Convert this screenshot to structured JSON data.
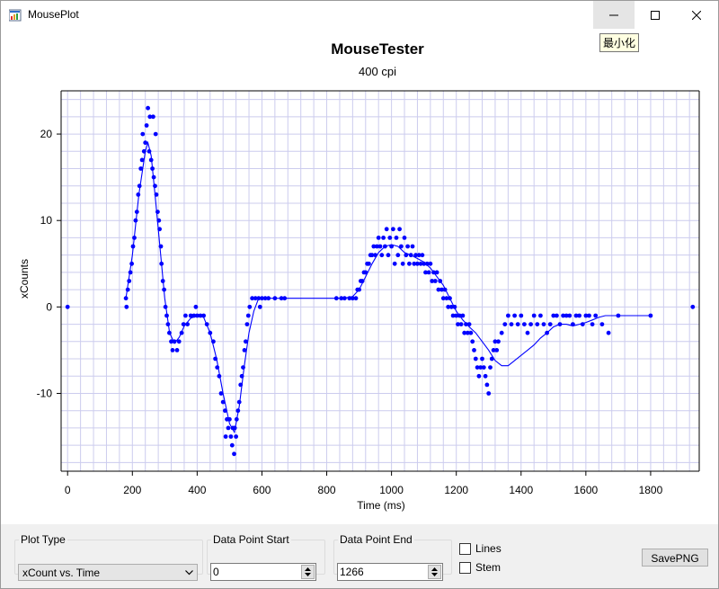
{
  "window": {
    "title": "MousePlot",
    "tooltip": "最小化"
  },
  "controls": {
    "plot_type_label": "Plot Type",
    "plot_type_value": "xCount vs. Time",
    "start_label": "Data Point Start",
    "start_value": "0",
    "end_label": "Data Point End",
    "end_value": "1266",
    "lines_label": "Lines",
    "stem_label": "Stem",
    "save_label": "SavePNG"
  },
  "chart_data": {
    "type": "scatter",
    "title": "MouseTester",
    "subtitle": "400 cpi",
    "xlabel": "Time (ms)",
    "ylabel": "xCounts",
    "xlim": [
      -20,
      1950
    ],
    "ylim": [
      -19,
      25
    ],
    "xticks": [
      0,
      200,
      400,
      600,
      800,
      1000,
      1200,
      1400,
      1600,
      1800
    ],
    "yticks": [
      -10,
      0,
      10,
      20
    ],
    "minor_grid_x_step": 40,
    "minor_grid_y_step": 2,
    "grid": true,
    "colors": {
      "points": "#0000ff",
      "line": "#0000ff",
      "grid": "#ccccee",
      "axis": "#000000"
    },
    "series": [
      {
        "points": [
          [
            0,
            0
          ],
          [
            180,
            1
          ],
          [
            182,
            0
          ],
          [
            186,
            2
          ],
          [
            190,
            3
          ],
          [
            194,
            4
          ],
          [
            198,
            5
          ],
          [
            202,
            7
          ],
          [
            206,
            8
          ],
          [
            210,
            10
          ],
          [
            214,
            11
          ],
          [
            218,
            13
          ],
          [
            222,
            14
          ],
          [
            226,
            16
          ],
          [
            230,
            17
          ],
          [
            232,
            20
          ],
          [
            236,
            18
          ],
          [
            240,
            19
          ],
          [
            244,
            21
          ],
          [
            248,
            23
          ],
          [
            252,
            18
          ],
          [
            254,
            22
          ],
          [
            258,
            17
          ],
          [
            262,
            16
          ],
          [
            264,
            22
          ],
          [
            266,
            15
          ],
          [
            270,
            14
          ],
          [
            272,
            20
          ],
          [
            274,
            13
          ],
          [
            278,
            11
          ],
          [
            282,
            10
          ],
          [
            284,
            9
          ],
          [
            288,
            7
          ],
          [
            290,
            5
          ],
          [
            294,
            3
          ],
          [
            298,
            2
          ],
          [
            302,
            0
          ],
          [
            306,
            -1
          ],
          [
            310,
            -2
          ],
          [
            314,
            -3
          ],
          [
            320,
            -4
          ],
          [
            324,
            -5
          ],
          [
            330,
            -4
          ],
          [
            338,
            -5
          ],
          [
            344,
            -4
          ],
          [
            352,
            -3
          ],
          [
            358,
            -2
          ],
          [
            364,
            -1
          ],
          [
            370,
            -2
          ],
          [
            380,
            -1
          ],
          [
            390,
            -1
          ],
          [
            396,
            0
          ],
          [
            400,
            -1
          ],
          [
            410,
            -1
          ],
          [
            420,
            -1
          ],
          [
            430,
            -2
          ],
          [
            440,
            -3
          ],
          [
            450,
            -4
          ],
          [
            456,
            -6
          ],
          [
            462,
            -7
          ],
          [
            468,
            -8
          ],
          [
            474,
            -10
          ],
          [
            480,
            -11
          ],
          [
            486,
            -12
          ],
          [
            488,
            -15
          ],
          [
            492,
            -13
          ],
          [
            496,
            -14
          ],
          [
            500,
            -13
          ],
          [
            504,
            -15
          ],
          [
            508,
            -16
          ],
          [
            510,
            -14
          ],
          [
            514,
            -17
          ],
          [
            516,
            -14
          ],
          [
            520,
            -15
          ],
          [
            522,
            -13
          ],
          [
            526,
            -12
          ],
          [
            530,
            -11
          ],
          [
            534,
            -9
          ],
          [
            538,
            -8
          ],
          [
            542,
            -7
          ],
          [
            546,
            -5
          ],
          [
            550,
            -4
          ],
          [
            554,
            -2
          ],
          [
            558,
            -1
          ],
          [
            562,
            0
          ],
          [
            570,
            1
          ],
          [
            580,
            1
          ],
          [
            590,
            1
          ],
          [
            594,
            0
          ],
          [
            600,
            1
          ],
          [
            610,
            1
          ],
          [
            620,
            1
          ],
          [
            640,
            1
          ],
          [
            660,
            1
          ],
          [
            670,
            1
          ],
          [
            830,
            1
          ],
          [
            845,
            1
          ],
          [
            855,
            1
          ],
          [
            870,
            1
          ],
          [
            880,
            1
          ],
          [
            890,
            1
          ],
          [
            895,
            2
          ],
          [
            900,
            2
          ],
          [
            905,
            3
          ],
          [
            910,
            3
          ],
          [
            915,
            4
          ],
          [
            920,
            4
          ],
          [
            925,
            5
          ],
          [
            930,
            5
          ],
          [
            935,
            6
          ],
          [
            940,
            6
          ],
          [
            945,
            7
          ],
          [
            950,
            6
          ],
          [
            955,
            7
          ],
          [
            960,
            8
          ],
          [
            965,
            7
          ],
          [
            970,
            6
          ],
          [
            975,
            8
          ],
          [
            980,
            7
          ],
          [
            985,
            9
          ],
          [
            990,
            6
          ],
          [
            995,
            8
          ],
          [
            1000,
            7
          ],
          [
            1005,
            9
          ],
          [
            1010,
            5
          ],
          [
            1015,
            8
          ],
          [
            1020,
            6
          ],
          [
            1025,
            9
          ],
          [
            1030,
            7
          ],
          [
            1035,
            5
          ],
          [
            1040,
            8
          ],
          [
            1045,
            6
          ],
          [
            1050,
            7
          ],
          [
            1055,
            5
          ],
          [
            1060,
            6
          ],
          [
            1065,
            7
          ],
          [
            1070,
            5
          ],
          [
            1075,
            6
          ],
          [
            1080,
            5
          ],
          [
            1085,
            6
          ],
          [
            1090,
            5
          ],
          [
            1095,
            6
          ],
          [
            1100,
            5
          ],
          [
            1105,
            4
          ],
          [
            1110,
            5
          ],
          [
            1115,
            4
          ],
          [
            1120,
            5
          ],
          [
            1125,
            3
          ],
          [
            1130,
            4
          ],
          [
            1135,
            3
          ],
          [
            1140,
            4
          ],
          [
            1145,
            2
          ],
          [
            1150,
            3
          ],
          [
            1155,
            2
          ],
          [
            1160,
            1
          ],
          [
            1165,
            2
          ],
          [
            1170,
            1
          ],
          [
            1175,
            0
          ],
          [
            1180,
            1
          ],
          [
            1185,
            0
          ],
          [
            1190,
            -1
          ],
          [
            1195,
            0
          ],
          [
            1200,
            -1
          ],
          [
            1205,
            -2
          ],
          [
            1210,
            -1
          ],
          [
            1215,
            -2
          ],
          [
            1220,
            -1
          ],
          [
            1225,
            -3
          ],
          [
            1230,
            -2
          ],
          [
            1235,
            -3
          ],
          [
            1240,
            -2
          ],
          [
            1245,
            -3
          ],
          [
            1250,
            -4
          ],
          [
            1255,
            -5
          ],
          [
            1260,
            -6
          ],
          [
            1265,
            -7
          ],
          [
            1270,
            -8
          ],
          [
            1275,
            -7
          ],
          [
            1280,
            -6
          ],
          [
            1285,
            -7
          ],
          [
            1290,
            -8
          ],
          [
            1295,
            -9
          ],
          [
            1300,
            -10
          ],
          [
            1305,
            -7
          ],
          [
            1310,
            -6
          ],
          [
            1315,
            -5
          ],
          [
            1320,
            -4
          ],
          [
            1325,
            -5
          ],
          [
            1330,
            -4
          ],
          [
            1340,
            -3
          ],
          [
            1350,
            -2
          ],
          [
            1360,
            -1
          ],
          [
            1370,
            -2
          ],
          [
            1380,
            -1
          ],
          [
            1390,
            -2
          ],
          [
            1400,
            -1
          ],
          [
            1410,
            -2
          ],
          [
            1420,
            -3
          ],
          [
            1430,
            -2
          ],
          [
            1440,
            -1
          ],
          [
            1450,
            -2
          ],
          [
            1460,
            -1
          ],
          [
            1470,
            -2
          ],
          [
            1480,
            -3
          ],
          [
            1490,
            -2
          ],
          [
            1500,
            -1
          ],
          [
            1510,
            -1
          ],
          [
            1520,
            -2
          ],
          [
            1530,
            -1
          ],
          [
            1540,
            -1
          ],
          [
            1550,
            -1
          ],
          [
            1560,
            -2
          ],
          [
            1570,
            -1
          ],
          [
            1580,
            -1
          ],
          [
            1590,
            -2
          ],
          [
            1600,
            -1
          ],
          [
            1610,
            -1
          ],
          [
            1620,
            -2
          ],
          [
            1630,
            -1
          ],
          [
            1650,
            -2
          ],
          [
            1670,
            -3
          ],
          [
            1700,
            -1
          ],
          [
            1800,
            -1
          ],
          [
            1930,
            0
          ]
        ],
        "line": [
          [
            180,
            1
          ],
          [
            200,
            6
          ],
          [
            220,
            13
          ],
          [
            240,
            18
          ],
          [
            248,
            19
          ],
          [
            258,
            17.5
          ],
          [
            270,
            13
          ],
          [
            285,
            7
          ],
          [
            300,
            1
          ],
          [
            315,
            -3
          ],
          [
            330,
            -4.2
          ],
          [
            345,
            -3.5
          ],
          [
            360,
            -2.2
          ],
          [
            380,
            -1.3
          ],
          [
            400,
            -1
          ],
          [
            420,
            -1.2
          ],
          [
            440,
            -3
          ],
          [
            460,
            -6
          ],
          [
            480,
            -10
          ],
          [
            500,
            -13.5
          ],
          [
            515,
            -14.5
          ],
          [
            530,
            -11.5
          ],
          [
            545,
            -7
          ],
          [
            560,
            -3
          ],
          [
            575,
            -0.5
          ],
          [
            590,
            1
          ],
          [
            620,
            1
          ],
          [
            670,
            1
          ],
          [
            850,
            1
          ],
          [
            880,
            1.2
          ],
          [
            900,
            2
          ],
          [
            920,
            3.5
          ],
          [
            940,
            5
          ],
          [
            960,
            6.3
          ],
          [
            980,
            7
          ],
          [
            1000,
            7.2
          ],
          [
            1020,
            7
          ],
          [
            1040,
            6.3
          ],
          [
            1060,
            6
          ],
          [
            1080,
            5.6
          ],
          [
            1100,
            5.2
          ],
          [
            1120,
            4.5
          ],
          [
            1140,
            3.5
          ],
          [
            1160,
            2.5
          ],
          [
            1180,
            1
          ],
          [
            1200,
            -0.5
          ],
          [
            1220,
            -1.5
          ],
          [
            1240,
            -2.3
          ],
          [
            1260,
            -3
          ],
          [
            1280,
            -4
          ],
          [
            1300,
            -5
          ],
          [
            1320,
            -6.2
          ],
          [
            1340,
            -6.8
          ],
          [
            1360,
            -6.8
          ],
          [
            1380,
            -6.2
          ],
          [
            1400,
            -5.6
          ],
          [
            1420,
            -5
          ],
          [
            1440,
            -4.4
          ],
          [
            1460,
            -3.6
          ],
          [
            1480,
            -3
          ],
          [
            1500,
            -2.3
          ],
          [
            1520,
            -2
          ],
          [
            1540,
            -2
          ],
          [
            1560,
            -2.2
          ],
          [
            1580,
            -2
          ],
          [
            1600,
            -1.8
          ],
          [
            1620,
            -1.5
          ],
          [
            1640,
            -1.2
          ],
          [
            1660,
            -1
          ],
          [
            1680,
            -1
          ],
          [
            1700,
            -1
          ],
          [
            1720,
            -1
          ],
          [
            1750,
            -1
          ],
          [
            1780,
            -1
          ],
          [
            1800,
            -1
          ]
        ]
      }
    ]
  }
}
